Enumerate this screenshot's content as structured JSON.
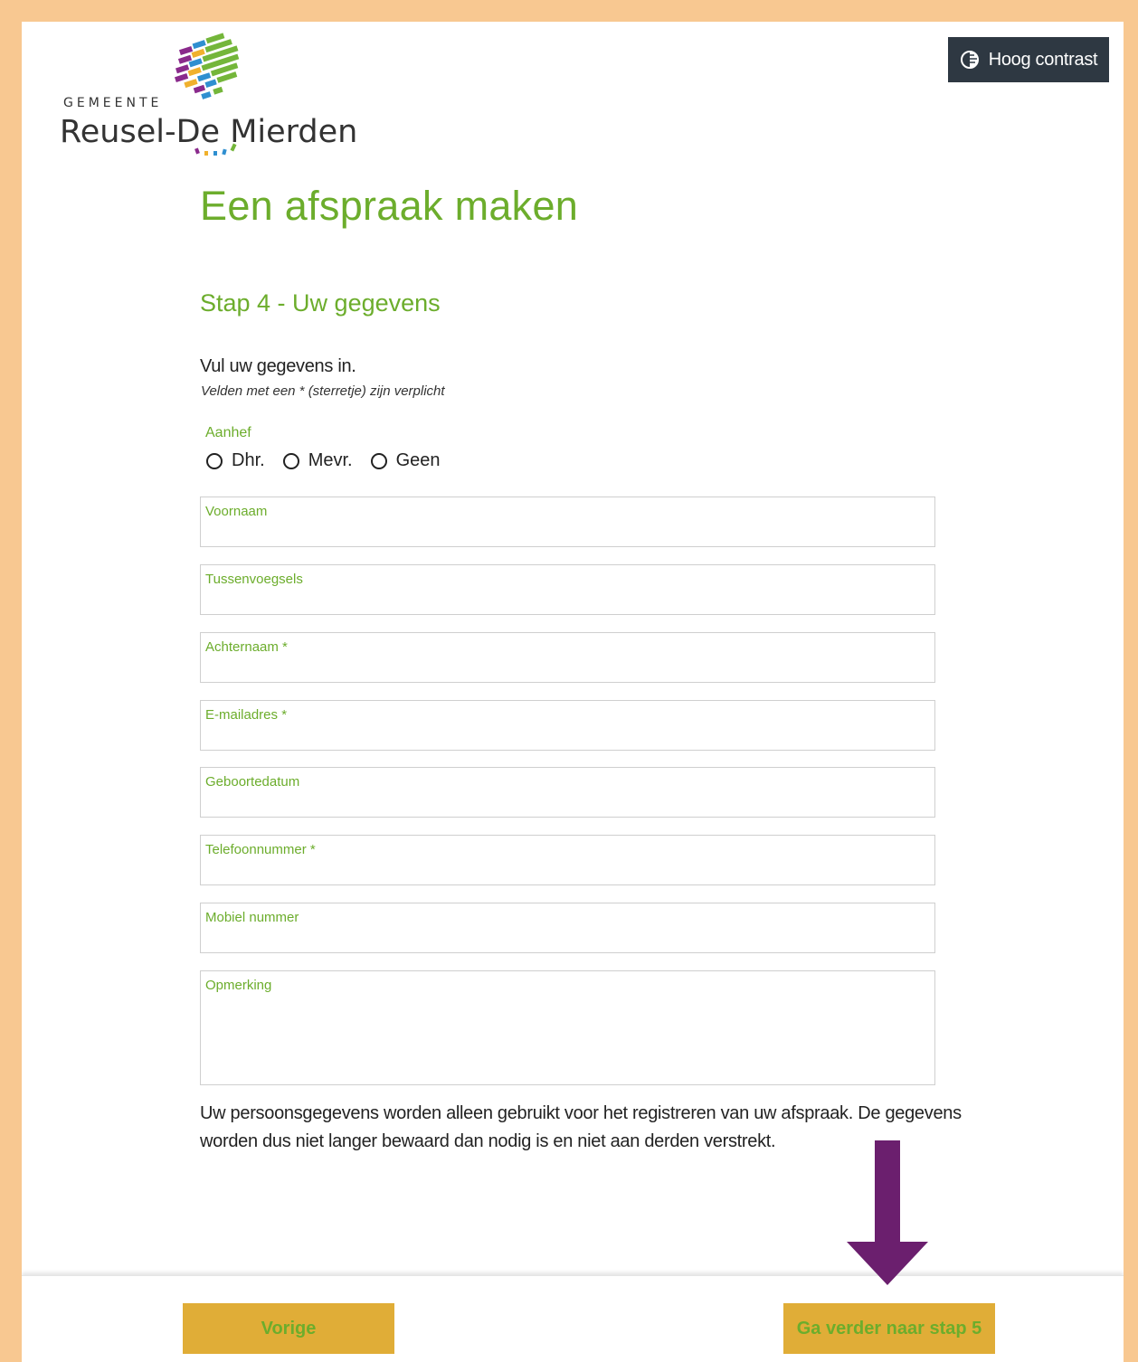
{
  "header": {
    "logo_top": "GEMEENTE",
    "logo_name": "Reusel-De Mierden",
    "contrast_label": "Hoog contrast"
  },
  "page": {
    "title": "Een afspraak maken",
    "step_title": "Stap 4 - Uw gegevens",
    "intro": "Vul uw gegevens in.",
    "note": "Velden met een * (sterretje) zijn verplicht"
  },
  "salutation": {
    "label": "Aanhef",
    "options": [
      "Dhr.",
      "Mevr.",
      "Geen"
    ]
  },
  "fields": [
    {
      "label": "Voornaam"
    },
    {
      "label": "Tussenvoegsels"
    },
    {
      "label": "Achternaam *"
    },
    {
      "label": "E-mailadres *"
    },
    {
      "label": "Geboortedatum"
    },
    {
      "label": "Telefoonnummer *"
    },
    {
      "label": "Mobiel nummer"
    },
    {
      "label": "Opmerking"
    }
  ],
  "privacy_text": "Uw persoonsgegevens worden alleen gebruikt voor het registreren van uw afspraak. De gegevens worden dus niet langer bewaard dan nodig is en niet aan derden verstrekt.",
  "footer": {
    "prev_label": "Vorige",
    "next_label": "Ga verder naar stap 5"
  },
  "colors": {
    "accent_green": "#6cad2c",
    "button_yellow": "#e0ad37",
    "arrow_purple": "#6b1f6e",
    "frame_orange": "#f8c891"
  }
}
